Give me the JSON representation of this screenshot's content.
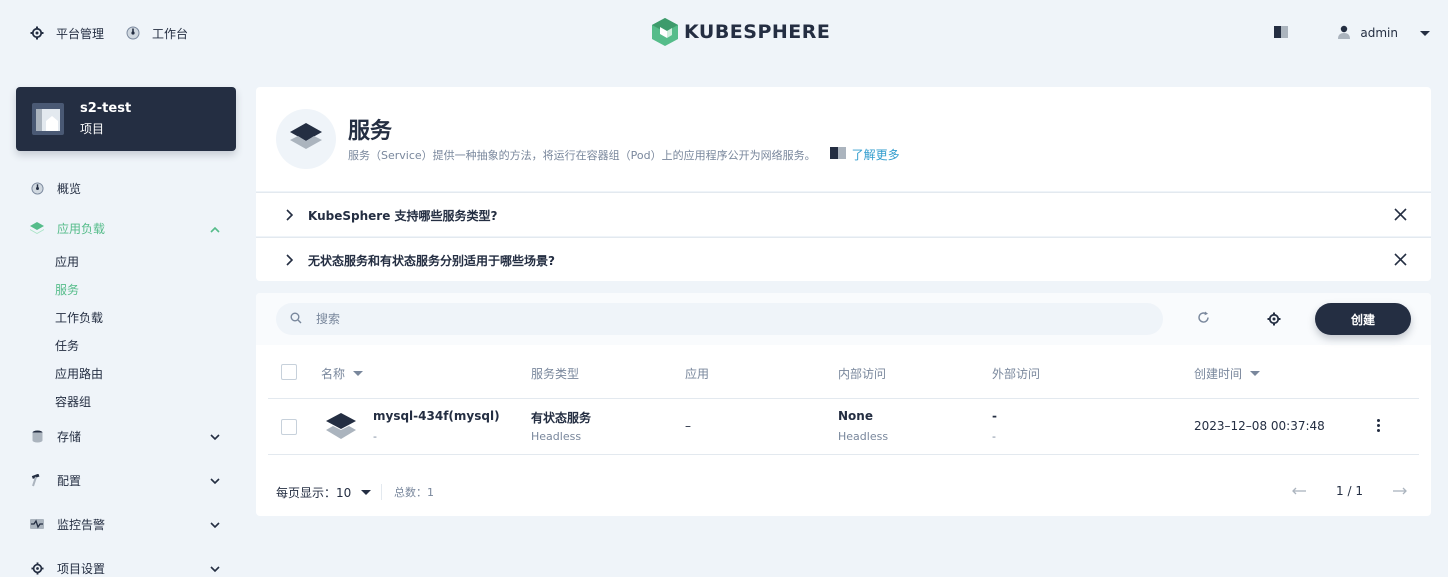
{
  "topbar": {
    "platform_label": "平台管理",
    "workbench_label": "工作台",
    "logo_text": "KUBESPHERE",
    "user_name": "admin"
  },
  "sidebar": {
    "project_name": "s2-test",
    "project_type": "项目",
    "overview": "概览",
    "workloads_group": "应用负载",
    "sub_items": [
      "应用",
      "服务",
      "工作负载",
      "任务",
      "应用路由",
      "容器组"
    ],
    "active_sub": "服务",
    "storage": "存储",
    "config": "配置",
    "monitoring": "监控告警",
    "project_settings": "项目设置"
  },
  "header": {
    "title": "服务",
    "description": "服务（Service）提供一种抽象的方法，将运行在容器组（Pod）上的应用程序公开为网络服务。",
    "learn_more": "了解更多"
  },
  "faq": [
    "KubeSphere 支持哪些服务类型?",
    "无状态服务和有状态服务分别适用于哪些场景?"
  ],
  "toolbar": {
    "search_placeholder": "搜索",
    "create_label": "创建"
  },
  "table": {
    "columns": [
      "名称",
      "服务类型",
      "应用",
      "内部访问",
      "外部访问",
      "创建时间"
    ],
    "rows": [
      {
        "name": "mysql-434f(mysql)",
        "name_sub": "-",
        "service_type": "有状态服务",
        "service_type_sub": "Headless",
        "app": "–",
        "internal": "None",
        "internal_sub": "Headless",
        "external": "-",
        "external_sub": "-",
        "created": "2023–12–08 00:37:48"
      }
    ]
  },
  "footer": {
    "per_page_label": "每页显示：",
    "per_page_value": "10",
    "total_label": "总数：",
    "total_value": "1",
    "page_indicator": "1 / 1"
  },
  "colors": {
    "dark": "#242e42",
    "accent_green": "#55bc8a",
    "link_blue": "#329dce",
    "muted": "#79879c",
    "page_bg": "#eff4f9"
  }
}
